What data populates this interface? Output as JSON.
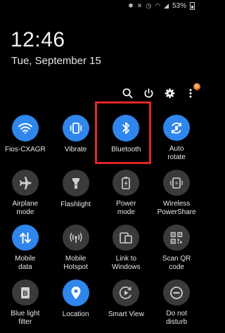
{
  "status_bar": {
    "battery_text": "53%"
  },
  "clock": {
    "time": "12:46",
    "date": "Tue, September 15"
  },
  "top_actions": {
    "notification_badge": "N"
  },
  "colors": {
    "active_tile": "#2f86ec",
    "inactive_tile": "#3a3a3a",
    "highlight_border": "#e32522",
    "badge": "#e8802a"
  },
  "tiles": [
    {
      "label": "Fios-CXAGR",
      "icon": "wifi-icon",
      "active": true
    },
    {
      "label": "Vibrate",
      "icon": "vibrate-icon",
      "active": true
    },
    {
      "label": "Bluetooth",
      "icon": "bluetooth-icon",
      "active": true,
      "highlighted": true
    },
    {
      "label": "Auto\nrotate",
      "icon": "auto-rotate-icon",
      "active": true
    },
    {
      "label": "Airplane\nmode",
      "icon": "airplane-icon",
      "active": false
    },
    {
      "label": "Flashlight",
      "icon": "flashlight-icon",
      "active": false
    },
    {
      "label": "Power\nmode",
      "icon": "power-mode-icon",
      "active": false
    },
    {
      "label": "Wireless\nPowerShare",
      "icon": "wireless-powershare-icon",
      "active": false
    },
    {
      "label": "Mobile\ndata",
      "icon": "mobile-data-icon",
      "active": true
    },
    {
      "label": "Mobile\nHotspot",
      "icon": "hotspot-icon",
      "active": false
    },
    {
      "label": "Link to\nWindows",
      "icon": "link-to-windows-icon",
      "active": false
    },
    {
      "label": "Scan QR\ncode",
      "icon": "qr-code-icon",
      "active": false
    },
    {
      "label": "Blue light\nfilter",
      "icon": "blue-light-filter-icon",
      "active": false
    },
    {
      "label": "Location",
      "icon": "location-icon",
      "active": true
    },
    {
      "label": "Smart View",
      "icon": "smart-view-icon",
      "active": false
    },
    {
      "label": "Do not\ndisturb",
      "icon": "do-not-disturb-icon",
      "active": false
    }
  ]
}
